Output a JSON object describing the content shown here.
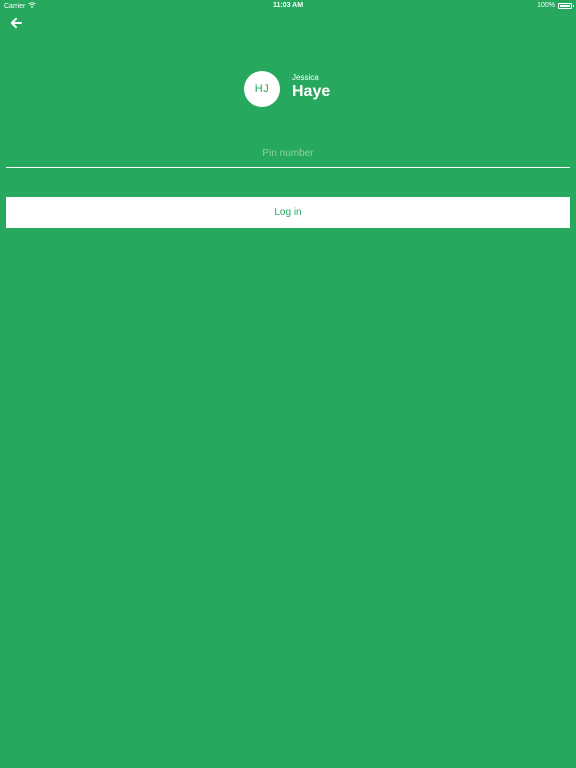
{
  "status_bar": {
    "carrier": "Carrier",
    "time": "11:03 AM",
    "battery": "100%",
    "battery_level": 1.0
  },
  "header": {
    "back_icon": "arrow-left-icon"
  },
  "profile": {
    "initials": "HJ",
    "first_name": "Jessica",
    "last_name": "Haye"
  },
  "login_form": {
    "pin_placeholder": "Pin number",
    "pin_value": "",
    "login_label": "Log in"
  },
  "colors": {
    "background": "#27a85f",
    "foreground": "#ffffff"
  }
}
